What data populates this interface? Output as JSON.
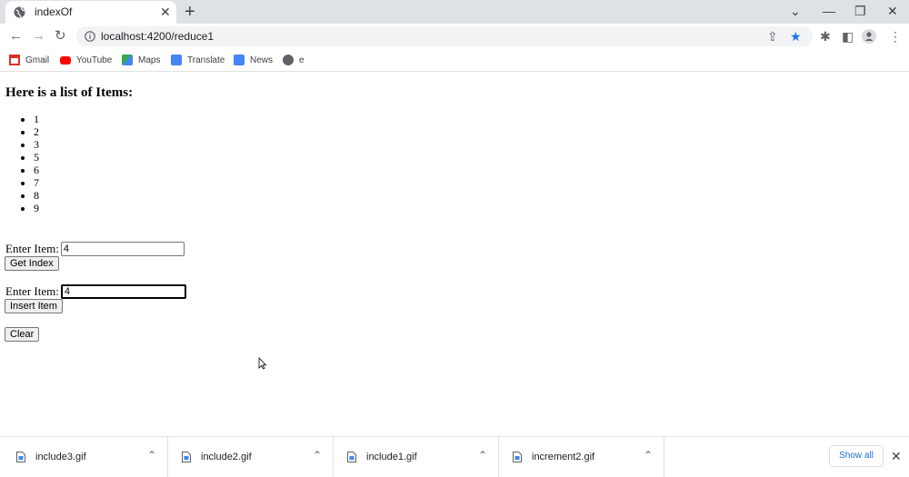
{
  "browser": {
    "tab_title": "indexOf",
    "new_tab": "+",
    "url": "localhost:4200/reduce1",
    "bookmarks": [
      {
        "label": "Gmail",
        "icon": "gmail-icon",
        "color": "#d93025"
      },
      {
        "label": "YouTube",
        "icon": "youtube-icon",
        "color": "#ff0000"
      },
      {
        "label": "Maps",
        "icon": "maps-icon",
        "color": "#34a853"
      },
      {
        "label": "Translate",
        "icon": "translate-icon",
        "color": "#4285f4"
      },
      {
        "label": "News",
        "icon": "news-icon",
        "color": "#4285f4"
      },
      {
        "label": "e",
        "icon": "globe-icon",
        "color": "#5f6368"
      }
    ]
  },
  "page": {
    "heading": "Here is a list of Items:",
    "items": [
      "1",
      "2",
      "3",
      "5",
      "6",
      "7",
      "8",
      "9"
    ],
    "form1": {
      "label": "Enter Item:",
      "value": "4",
      "button": "Get Index"
    },
    "form2": {
      "label": "Enter Item:",
      "value": "4",
      "button": "Insert Item"
    },
    "clear_button": "Clear"
  },
  "downloads": {
    "files": [
      "include3.gif",
      "include2.gif",
      "include1.gif",
      "increment2.gif"
    ],
    "show_all": "Show all"
  }
}
